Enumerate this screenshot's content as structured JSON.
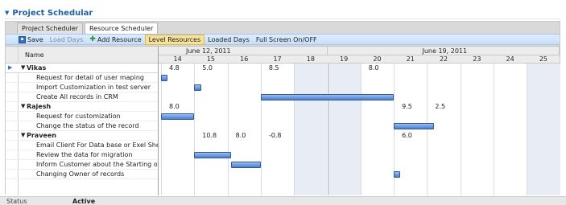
{
  "app": {
    "title": "Project Schedular"
  },
  "tabs": [
    {
      "label": "Project Scheduler",
      "active": false
    },
    {
      "label": "Resource Scheduler",
      "active": true
    }
  ],
  "toolbar": {
    "save": "Save",
    "load_days": "Load Days",
    "add_resource": "Add Resource",
    "level_resources": "Level Resources",
    "loaded_days": "Loaded Days",
    "full_screen": "Full Screen On/OFF"
  },
  "grid": {
    "name_header": "Name",
    "weeks": [
      "June 12, 2011",
      "June 19, 2011"
    ],
    "days": [
      "14",
      "15",
      "16",
      "17",
      "18",
      "19",
      "20",
      "21",
      "22",
      "23",
      "24",
      "25"
    ],
    "weekend_days": [
      "18",
      "19",
      "25"
    ],
    "rows": [
      {
        "name": "Vikas",
        "parent": true,
        "selected": true,
        "loads": [
          {
            "day": "14",
            "value": "4.8"
          },
          {
            "day": "15",
            "value": "5.0"
          },
          {
            "day": "17",
            "value": "8.5"
          },
          {
            "day": "20",
            "value": "8.0"
          }
        ]
      },
      {
        "name": "Request for detail of user maping",
        "parent": false,
        "bar": {
          "start_day": 14.0,
          "end_day": 14.2
        }
      },
      {
        "name": "Import Customization in test server",
        "parent": false,
        "bar": {
          "start_day": 15.0,
          "end_day": 15.2
        }
      },
      {
        "name": "Create All records in CRM",
        "parent": false,
        "bar": {
          "start_day": 17.0,
          "end_day": 21.0
        }
      },
      {
        "name": "Rajesh",
        "parent": true,
        "loads": [
          {
            "day": "14",
            "value": "8.0"
          },
          {
            "day": "21",
            "value": "9.5"
          },
          {
            "day": "22",
            "value": "2.5"
          }
        ]
      },
      {
        "name": "Request for customization",
        "parent": false,
        "bar": {
          "start_day": 14.0,
          "end_day": 15.0
        }
      },
      {
        "name": "Change the status of the record",
        "parent": false,
        "bar": {
          "start_day": 21.0,
          "end_day": 22.2
        }
      },
      {
        "name": "Praveen",
        "parent": true,
        "loads": [
          {
            "day": "15",
            "value": "10.8"
          },
          {
            "day": "16",
            "value": "8.0"
          },
          {
            "day": "17",
            "value": "-0.8"
          },
          {
            "day": "21",
            "value": "6.0"
          }
        ]
      },
      {
        "name": "Email Client For Data base or Exel Sheet",
        "parent": false
      },
      {
        "name": "Review the data for migration",
        "parent": false,
        "bar": {
          "start_day": 15.0,
          "end_day": 16.1
        }
      },
      {
        "name": "Inform Customer about the Starting of da",
        "parent": false,
        "bar": {
          "start_day": 16.1,
          "end_day": 17.0
        }
      },
      {
        "name": "Changing Owner of records",
        "parent": false,
        "bar": {
          "start_day": 21.0,
          "end_day": 21.2
        }
      }
    ]
  },
  "status": {
    "label": "Status",
    "value": "Active"
  }
}
